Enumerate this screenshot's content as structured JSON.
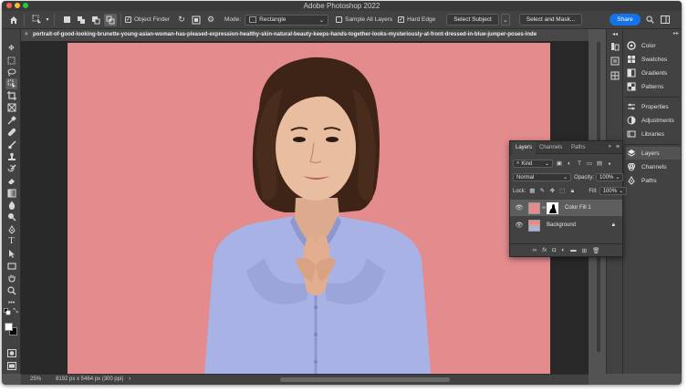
{
  "app": {
    "title": "Adobe Photoshop 2022"
  },
  "options_bar": {
    "object_finder_label": "Object Finder",
    "object_finder_checked": true,
    "mode_label": "Mode:",
    "mode_value": "Rectangle",
    "sample_all_layers_label": "Sample All Layers",
    "sample_all_layers_checked": false,
    "hard_edge_label": "Hard Edge",
    "hard_edge_checked": true,
    "select_subject_label": "Select Subject",
    "select_and_mask_label": "Select and Mask...",
    "share_label": "Share"
  },
  "document": {
    "tab_title": "portrait-of-good-looking-brunette-young-asian-woman-has-pleased-expression-healthy-skin-natural-beauty-keeps-hands-together-looks-mysteriously-at-front-dressed-in-blue-jumper-poses-inde",
    "zoom": "25%",
    "info": "8192 px x 5464 px (300 ppi)",
    "background_color": "#e38b8d"
  },
  "right_panels": {
    "group1": [
      {
        "label": "Color",
        "icon": "color-wheel-icon"
      },
      {
        "label": "Swatches",
        "icon": "swatches-grid-icon"
      },
      {
        "label": "Gradients",
        "icon": "gradient-icon"
      },
      {
        "label": "Patterns",
        "icon": "pattern-icon"
      }
    ],
    "group2": [
      {
        "label": "Properties",
        "icon": "sliders-icon"
      },
      {
        "label": "Adjustments",
        "icon": "adjustments-circle-icon"
      },
      {
        "label": "Libraries",
        "icon": "libraries-icon"
      }
    ],
    "group3": [
      {
        "label": "Layers",
        "icon": "layers-stack-icon",
        "selected": true
      },
      {
        "label": "Channels",
        "icon": "channels-icon"
      },
      {
        "label": "Paths",
        "icon": "paths-pen-icon"
      }
    ]
  },
  "layers_panel": {
    "tabs": [
      "Layers",
      "Channels",
      "Paths"
    ],
    "active_tab": "Layers",
    "filter_kind": "Kind",
    "blend_mode": "Normal",
    "opacity_label": "Opacity:",
    "opacity_value": "100%",
    "lock_label": "Lock:",
    "fill_label": "Fill:",
    "fill_value": "100%",
    "layers": [
      {
        "name": "Color Fill 1",
        "selected": true,
        "visible": true,
        "thumb_color": "#e38b8d",
        "has_mask": true
      },
      {
        "name": "Background",
        "selected": false,
        "visible": true,
        "locked": true
      }
    ]
  },
  "colors": {
    "foreground": "#ffffff",
    "background": "#000000",
    "accent": "#1473e6"
  }
}
